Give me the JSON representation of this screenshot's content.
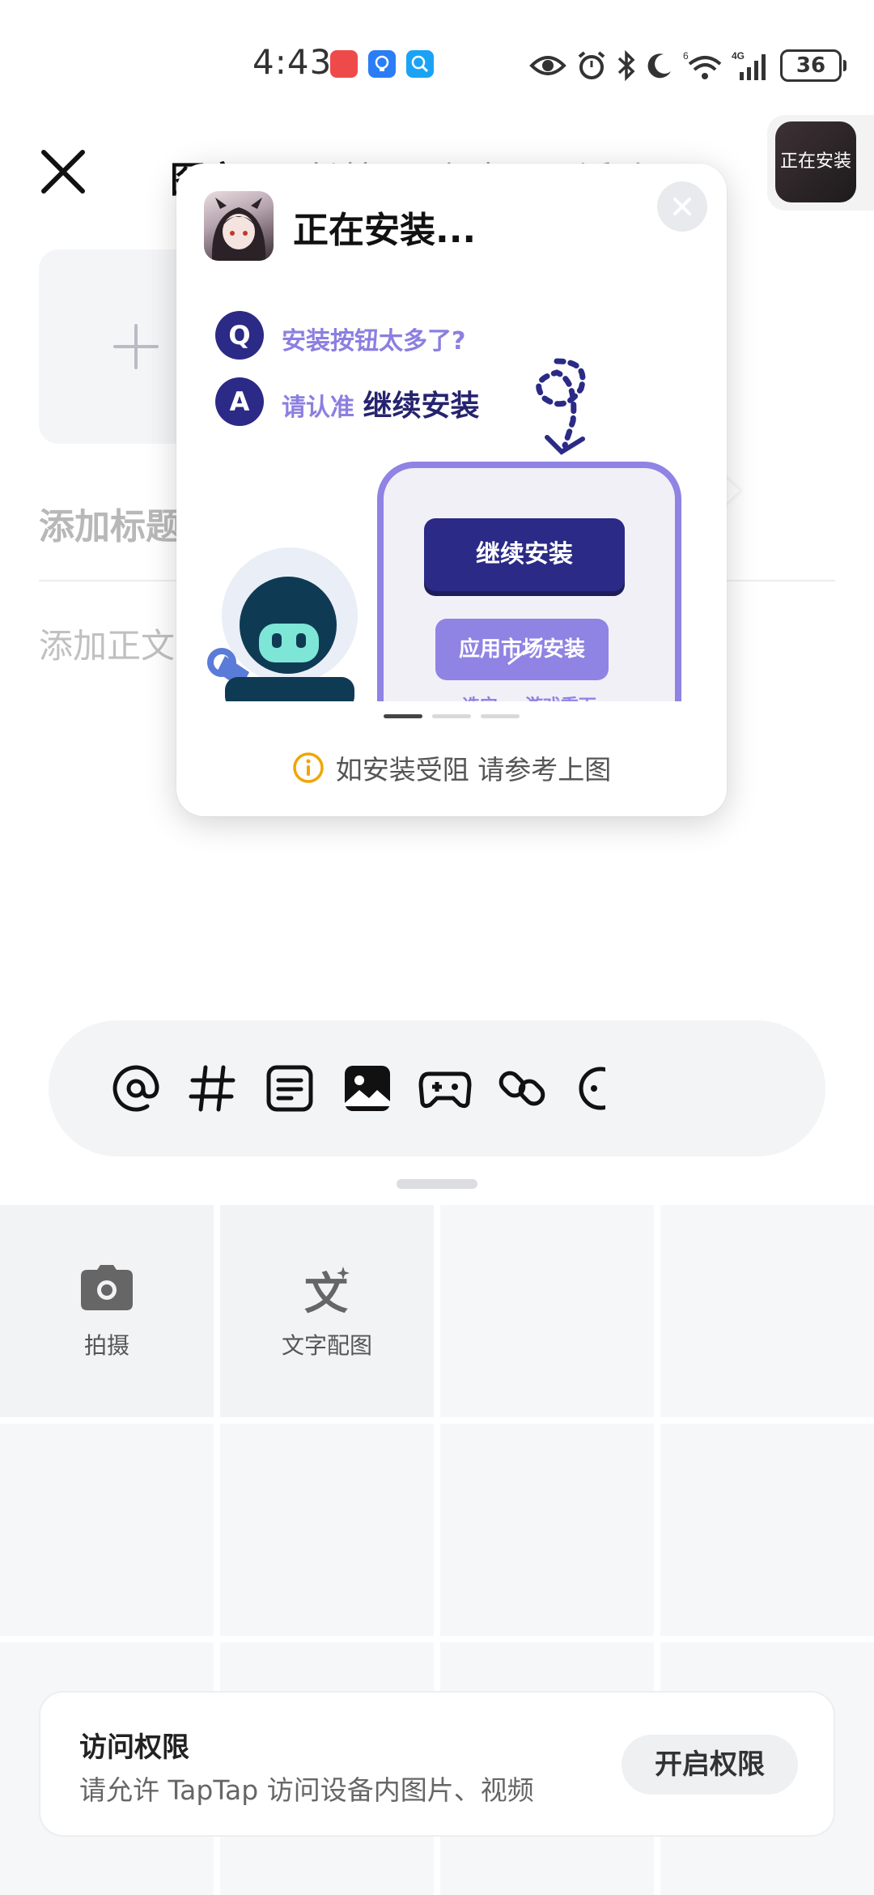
{
  "status_bar": {
    "time": "4:43",
    "network": "4G",
    "wifi_badge": "6",
    "battery": "36"
  },
  "header": {
    "tabs": [
      "图文",
      "长帖",
      "视频",
      "活动"
    ],
    "installing_chip": "正在安装"
  },
  "editor": {
    "title_placeholder": "添加标题",
    "body_placeholder": "添加正文"
  },
  "toolbar": {
    "icons": [
      "at-icon",
      "hashtag-icon",
      "document-icon",
      "image-icon",
      "gamepad-icon",
      "link-icon",
      "more-icon"
    ]
  },
  "gallery": {
    "camera_label": "拍摄",
    "text_image_label": "文字配图"
  },
  "permission": {
    "title": "访问权限",
    "description": "请允许 TapTap 访问设备内图片、视频",
    "button": "开启权限"
  },
  "popup": {
    "title": "正在安装...",
    "q_badge": "Q",
    "question": "安装按钮太多了?",
    "a_badge": "A",
    "answer_prefix": "请认准",
    "answer_strong": "继续安装",
    "continue_button": "继续安装",
    "market_button": "应用市场安装",
    "phone_note": "选它 = 游戏重下",
    "pagination": {
      "total": 3,
      "active": 1
    },
    "hint": "如安装受阻 请参考上图"
  },
  "colors": {
    "accent_dark": "#2b2a86",
    "accent_light": "#8f83e4",
    "warning": "#f0a500"
  }
}
